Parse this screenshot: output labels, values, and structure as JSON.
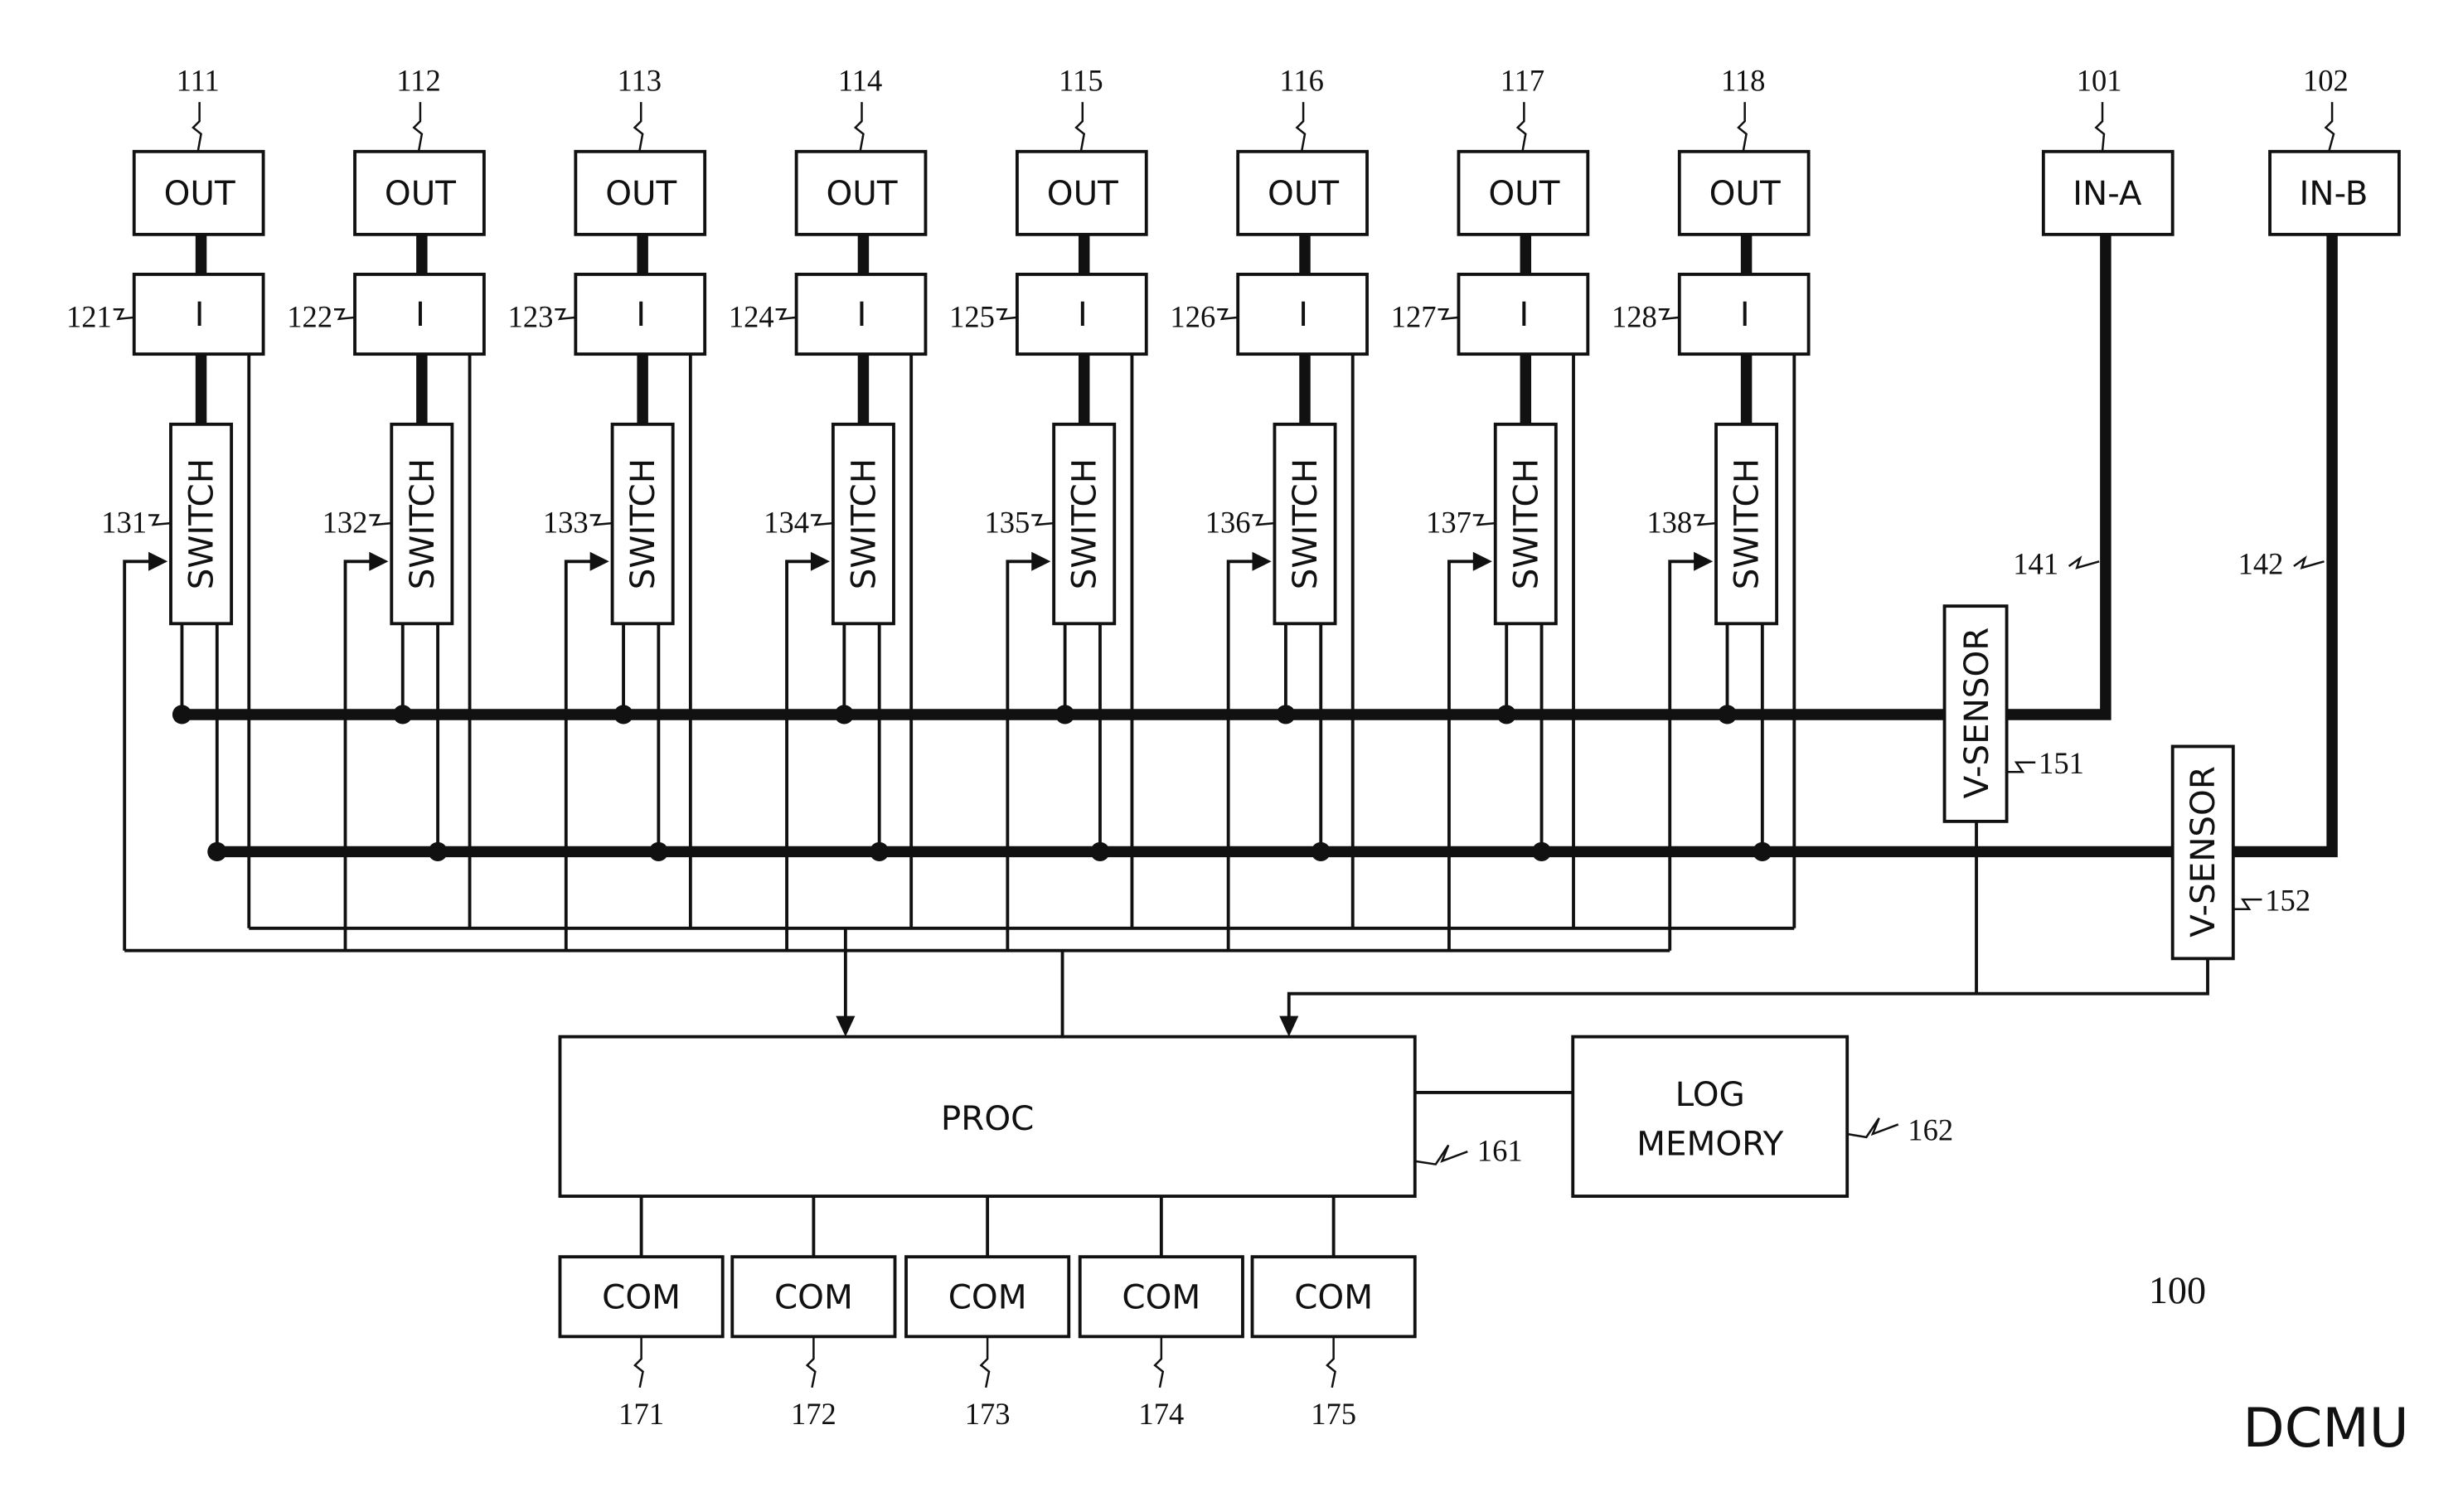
{
  "figure": {
    "title": "DCMU",
    "reference": "100"
  },
  "inputs": [
    {
      "ref": "101",
      "label": "IN-A",
      "line_ref": "141",
      "sensor_ref": "151",
      "sensor_label": "V-SENSOR"
    },
    {
      "ref": "102",
      "label": "IN-B",
      "line_ref": "142",
      "sensor_ref": "152",
      "sensor_label": "V-SENSOR"
    }
  ],
  "channels": [
    {
      "out_ref": "111",
      "out_label": "OUT",
      "i_ref": "121",
      "i_label": "I",
      "switch_ref": "131",
      "switch_label": "SWITCH"
    },
    {
      "out_ref": "112",
      "out_label": "OUT",
      "i_ref": "122",
      "i_label": "I",
      "switch_ref": "132",
      "switch_label": "SWITCH"
    },
    {
      "out_ref": "113",
      "out_label": "OUT",
      "i_ref": "123",
      "i_label": "I",
      "switch_ref": "133",
      "switch_label": "SWITCH"
    },
    {
      "out_ref": "114",
      "out_label": "OUT",
      "i_ref": "124",
      "i_label": "I",
      "switch_ref": "134",
      "switch_label": "SWITCH"
    },
    {
      "out_ref": "115",
      "out_label": "OUT",
      "i_ref": "125",
      "i_label": "I",
      "switch_ref": "135",
      "switch_label": "SWITCH"
    },
    {
      "out_ref": "116",
      "out_label": "OUT",
      "i_ref": "126",
      "i_label": "I",
      "switch_ref": "136",
      "switch_label": "SWITCH"
    },
    {
      "out_ref": "117",
      "out_label": "OUT",
      "i_ref": "127",
      "i_label": "I",
      "switch_ref": "137",
      "switch_label": "SWITCH"
    },
    {
      "out_ref": "118",
      "out_label": "OUT",
      "i_ref": "128",
      "i_label": "I",
      "switch_ref": "138",
      "switch_label": "SWITCH"
    }
  ],
  "processor": {
    "ref": "161",
    "label": "PROC"
  },
  "log_memory": {
    "ref": "162",
    "label_line1": "LOG",
    "label_line2": "MEMORY"
  },
  "com_ports": [
    {
      "ref": "171",
      "label": "COM"
    },
    {
      "ref": "172",
      "label": "COM"
    },
    {
      "ref": "173",
      "label": "COM"
    },
    {
      "ref": "174",
      "label": "COM"
    },
    {
      "ref": "175",
      "label": "COM"
    }
  ]
}
